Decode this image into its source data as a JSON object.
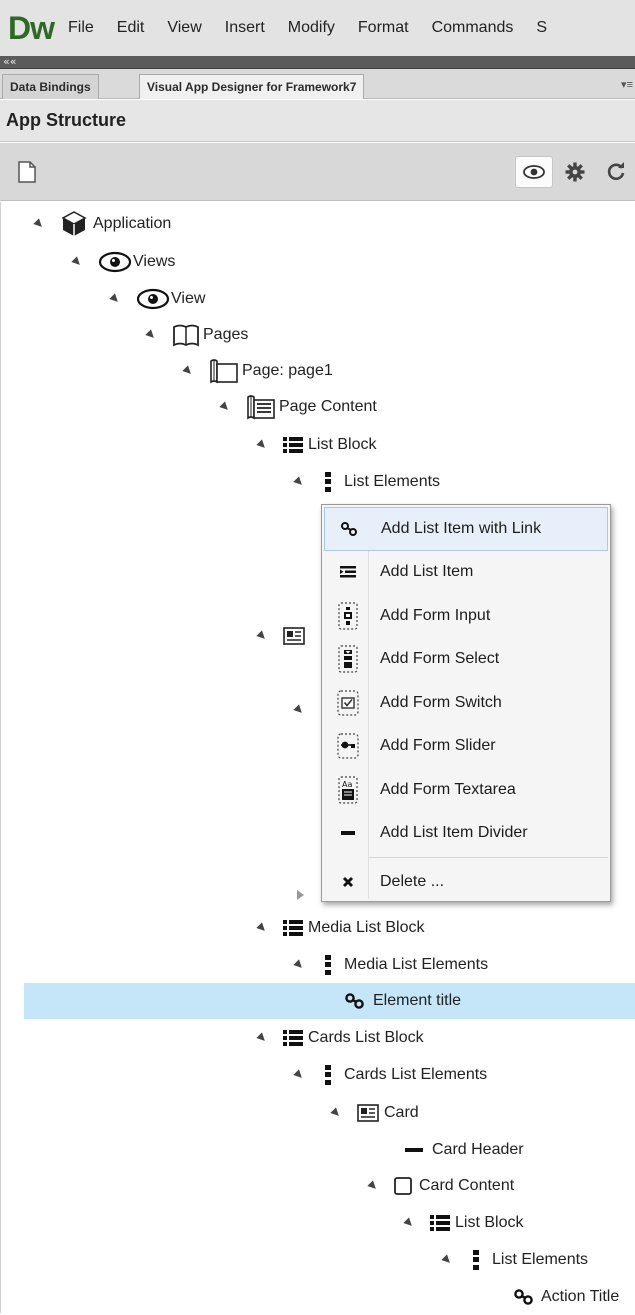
{
  "app": {
    "logo": "Dw",
    "menu": [
      "File",
      "Edit",
      "View",
      "Insert",
      "Modify",
      "Format",
      "Commands",
      "S"
    ]
  },
  "collapse_strip": {
    "arrows": "««"
  },
  "tabs": [
    {
      "label": "Data Bindings"
    },
    {
      "label": "Visual App Designer for Framework7"
    }
  ],
  "tab_menu": "▾≡",
  "panel": {
    "title": "App Structure"
  },
  "tree": {
    "application": "Application",
    "views": "Views",
    "view": "View",
    "pages": "Pages",
    "page": "Page: page1",
    "page_content": "Page Content",
    "list_block": "List Block",
    "list_elements": "List Elements",
    "media_list_block": "Media List Block",
    "media_list_elements": "Media List Elements",
    "element_title": "Element title",
    "cards_list_block": "Cards List Block",
    "cards_list_elements": "Cards List Elements",
    "card": "Card",
    "card_header": "Card Header",
    "card_content": "Card Content",
    "inner_list_block": "List Block",
    "inner_list_elements": "List Elements",
    "action_title": "Action Title"
  },
  "context_menu": {
    "items": [
      {
        "label": "Add List Item with Link",
        "icon": "link-icon"
      },
      {
        "label": "Add List Item",
        "icon": "list-item-icon"
      },
      {
        "label": "Add Form Input",
        "icon": "form-input-icon"
      },
      {
        "label": "Add Form Select",
        "icon": "form-select-icon"
      },
      {
        "label": "Add Form Switch",
        "icon": "form-switch-icon"
      },
      {
        "label": "Add Form Slider",
        "icon": "form-slider-icon"
      },
      {
        "label": "Add Form Textarea",
        "icon": "form-textarea-icon"
      },
      {
        "label": "Add List Item Divider",
        "icon": "divider-icon"
      },
      {
        "label": "Delete ...",
        "icon": "delete-icon"
      }
    ]
  },
  "colors": {
    "selection": "#c5e5f8",
    "logo": "#2e6a24",
    "menu_hover": "#e7f0fa"
  }
}
